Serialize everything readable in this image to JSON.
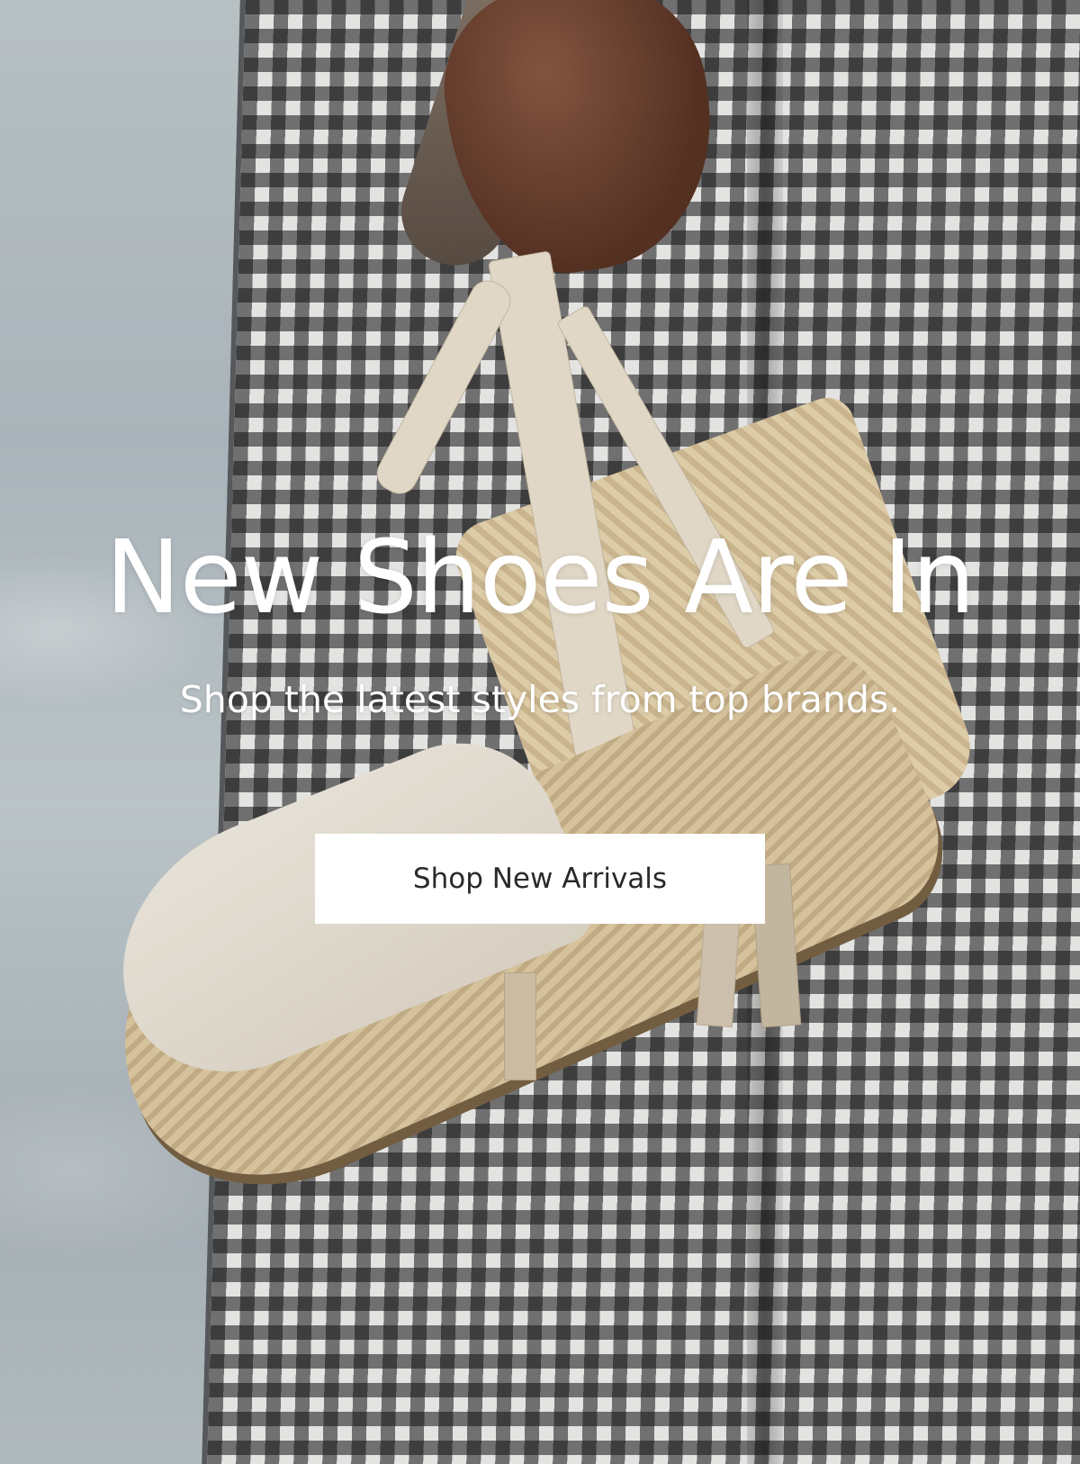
{
  "hero": {
    "title": "New Shoes Are In",
    "subtitle": "Shop the latest styles from top brands.",
    "cta_label": "Shop New Arrivals",
    "background_image": "person in black-and-white gingham holding a beige lace-up espadrille wedge by the sea",
    "colors": {
      "text": "#ffffff",
      "button_bg": "#ffffff",
      "button_text": "#2a2a2a"
    }
  }
}
